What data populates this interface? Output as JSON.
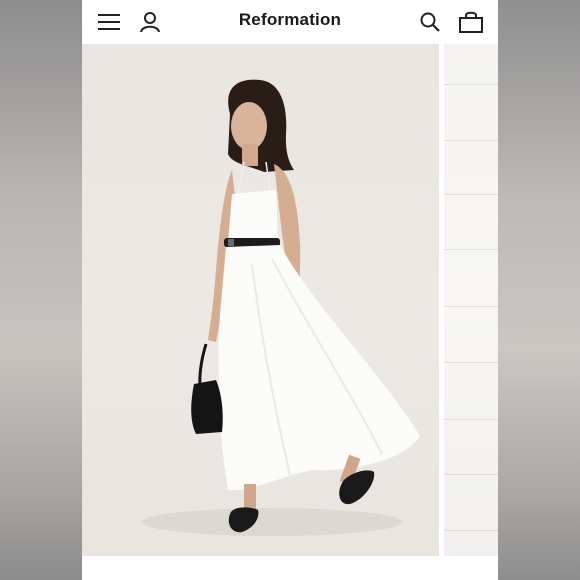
{
  "header": {
    "brand": "Reformation",
    "icons": [
      "menu-icon",
      "account-icon",
      "search-icon",
      "bag-icon"
    ]
  },
  "gallery": {
    "images": [
      {
        "subject": "model-in-white-dress",
        "role": "main"
      },
      {
        "subject": "fabric-closeup",
        "role": "next"
      }
    ]
  },
  "colors": {
    "header_bg": "#ffffff",
    "brand_text": "#1a1a1a",
    "photo_bg": "#eae7e2",
    "dress": "#fbfbf9",
    "belt": "#1c1c1c"
  }
}
